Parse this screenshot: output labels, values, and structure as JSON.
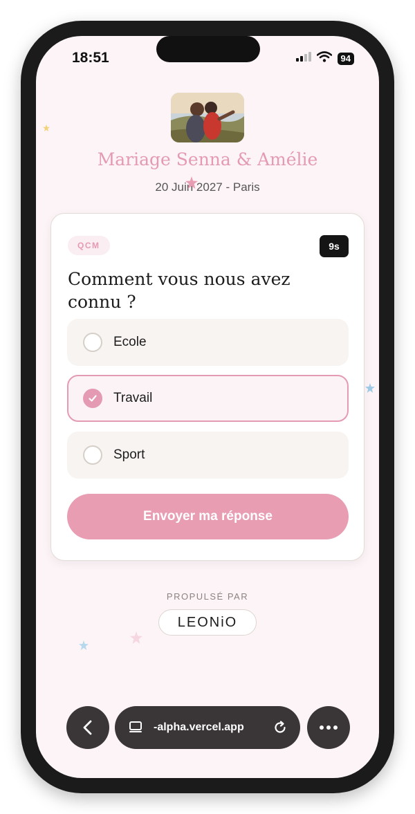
{
  "status_bar": {
    "time": "18:51",
    "battery": "94"
  },
  "event": {
    "title": "Mariage Senna & Amélie",
    "subtitle": "20 Juin 2027 - Paris"
  },
  "quiz": {
    "tag": "QCM",
    "timer": "9s",
    "question": "Comment vous nous avez connu ?",
    "options": [
      {
        "label": "Ecole",
        "selected": false
      },
      {
        "label": "Travail",
        "selected": true
      },
      {
        "label": "Sport",
        "selected": false
      }
    ],
    "submit_label": "Envoyer ma réponse"
  },
  "footer": {
    "powered_by": "PROPULSÉ PAR",
    "brand": "LEONiO"
  },
  "browser": {
    "url": "-alpha.vercel.app"
  },
  "colors": {
    "accent": "#e59ab3",
    "background": "#fcf4f6",
    "dark": "#3a3536"
  },
  "icons": [
    "signal-icon",
    "wifi-icon",
    "check-icon",
    "back-icon",
    "tabs-icon",
    "reload-icon",
    "more-icon"
  ]
}
